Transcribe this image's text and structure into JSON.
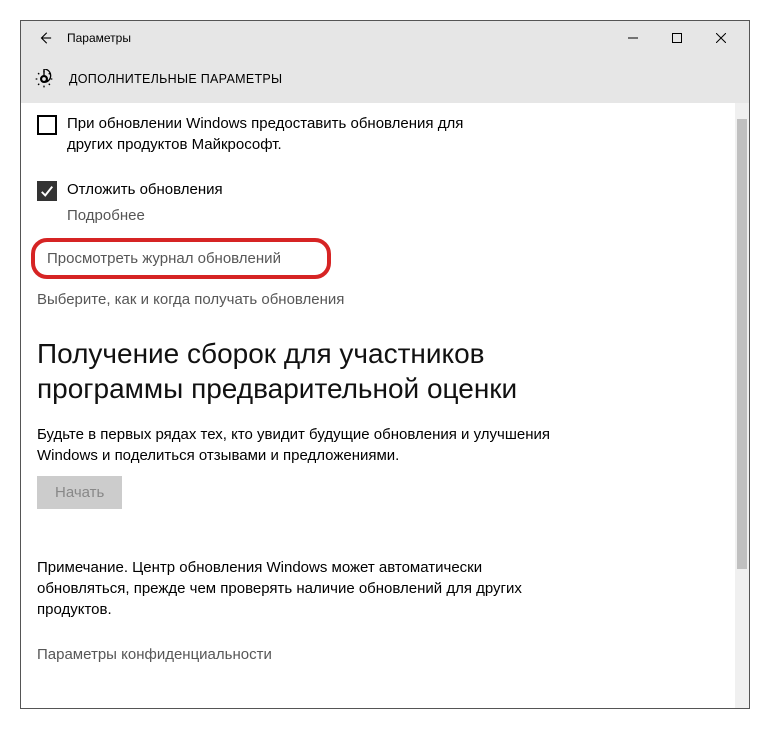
{
  "titlebar": {
    "title": "Параметры"
  },
  "header": {
    "title": "ДОПОЛНИТЕЛЬНЫЕ ПАРАМЕТРЫ"
  },
  "checks": {
    "other_products": {
      "checked": false,
      "label": "При обновлении Windows предоставить обновления для других продуктов Майкрософт."
    },
    "defer": {
      "checked": true,
      "label": "Отложить обновления",
      "more": "Подробнее"
    }
  },
  "links": {
    "history": "Просмотреть журнал обновлений",
    "schedule": "Выберите, как и когда получать обновления",
    "privacy": "Параметры конфиденциальности"
  },
  "insider": {
    "heading": "Получение сборок для участников программы предварительной оценки",
    "text": "Будьте в первых рядах тех, кто увидит будущие обновления и улучшения Windows и поделиться отзывами и предложениями.",
    "button": "Начать"
  },
  "note": "Примечание. Центр обновления Windows может автоматически обновляться, прежде чем проверять наличие обновлений для других продуктов."
}
